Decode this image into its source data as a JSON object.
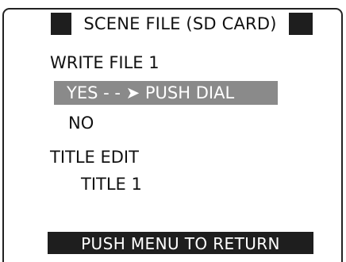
{
  "screen": {
    "title": "SCENE FILE (SD CARD)",
    "write_file_label": "WRITE FILE 1",
    "yes_option": "YES - - ➤  PUSH DIAL",
    "no_option": "NO",
    "title_edit_label": "TITLE EDIT",
    "title_value": "TITLE 1",
    "footer": "PUSH  MENU  TO  RETURN"
  },
  "colors": {
    "title_bar": "#1e1e1e",
    "selected_option_background": "#8a8a8a",
    "footer_background": "#1e1e1e",
    "text": "#111111",
    "frame": "#222222"
  }
}
